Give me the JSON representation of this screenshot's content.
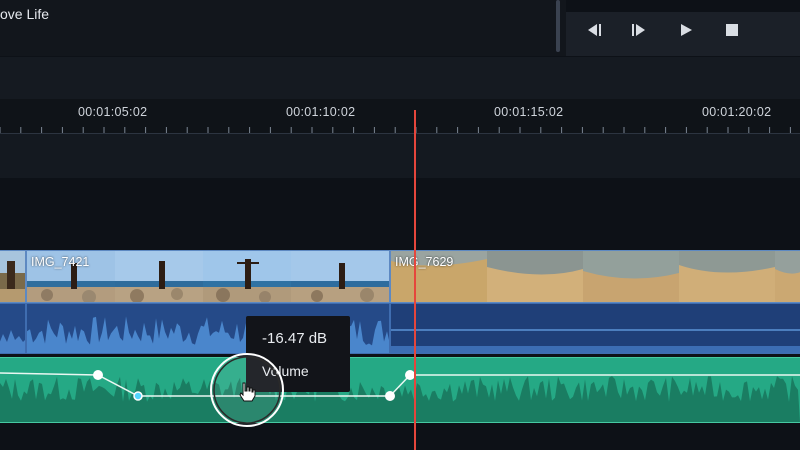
{
  "app": {
    "title": "ove Life"
  },
  "transport": {
    "prev_frame_icon": "step-back-icon",
    "next_frame_icon": "step-forward-icon",
    "play_icon": "play-icon",
    "stop_icon": "stop-icon",
    "prev_glyph": "◀|",
    "next_glyph": "|▶",
    "play_glyph": "▶",
    "stop_glyph": "■"
  },
  "ruler": {
    "labels": [
      "00:01:05:02",
      "00:01:10:02",
      "00:01:15:02",
      "00:01:20:02"
    ]
  },
  "clips": {
    "video1_name": "IMG_7421",
    "video2_name": "IMG_7629"
  },
  "tooltip": {
    "value": "-16.47 dB",
    "label": "Volume"
  },
  "colors": {
    "playhead": "#e5463c",
    "audio_track": "#25a985",
    "clip_audio": "#254a88",
    "clip_border": "#5d89c2"
  }
}
